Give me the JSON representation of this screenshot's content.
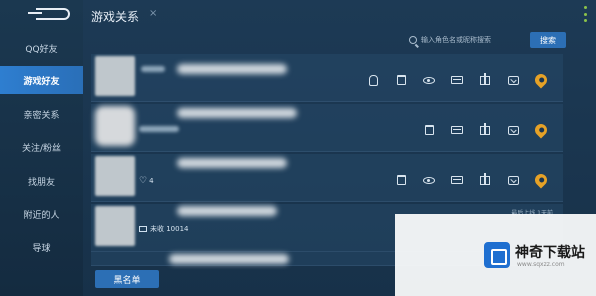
{
  "sidebar": {
    "items": [
      {
        "label": "QQ好友"
      },
      {
        "label": "游戏好友"
      },
      {
        "label": "亲密关系"
      },
      {
        "label": "关注/粉丝"
      },
      {
        "label": "找朋友"
      },
      {
        "label": "附近的人"
      },
      {
        "label": "导球"
      }
    ]
  },
  "header": {
    "title": "游戏关系",
    "close_glyph": "×"
  },
  "search": {
    "placeholder": "输入角色名或昵称搜索",
    "button_label": "搜索"
  },
  "rows": [
    {
      "tag": "",
      "status": ""
    },
    {
      "tag": "",
      "status": ""
    },
    {
      "tag": "",
      "status": "4"
    },
    {
      "tag": "最后上线 1天前",
      "status": "未收 10014"
    }
  ],
  "footer": {
    "blacklist_label": "黑名单"
  },
  "ad": {
    "title": "神奇下载站",
    "url": "www.sqxzz.com"
  },
  "colors": {
    "accent": "#2c6fb5",
    "active_nav": "#2e7ed0",
    "pin": "#e6a227"
  }
}
